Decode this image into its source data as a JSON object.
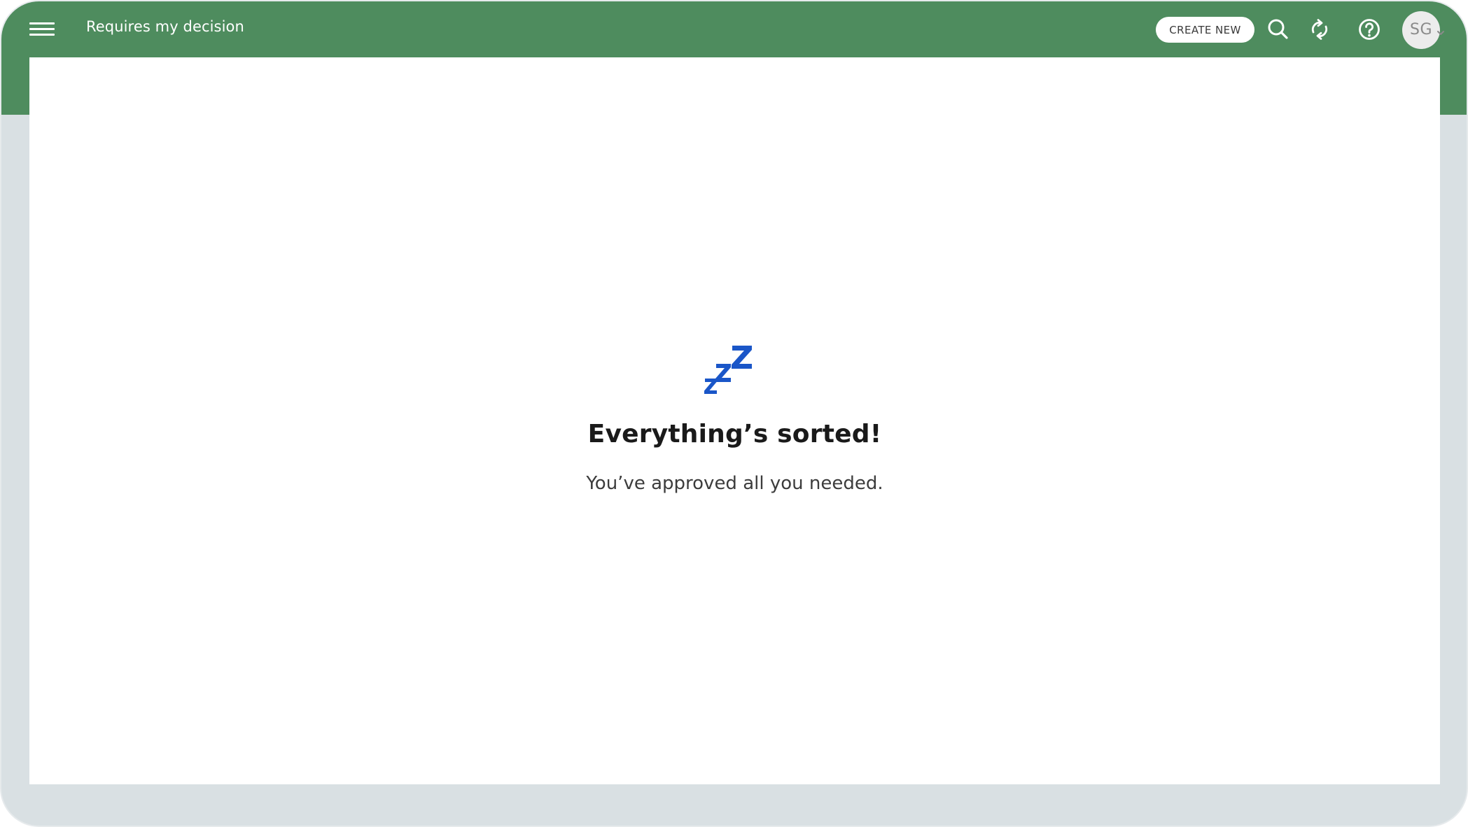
{
  "header": {
    "menu_icon": "hamburger-menu-icon",
    "title": "Requires my decision",
    "create_label": "CREATE NEW",
    "search_icon": "search-icon",
    "refresh_icon": "refresh-icon",
    "help_icon": "help-icon",
    "avatar_initials": "SG",
    "avatar_menu_icon": "chevron-down-icon"
  },
  "empty_state": {
    "icon": "sleeping-zzz-icon",
    "title": "Everything’s sorted!",
    "subtitle": "You’ve approved all you needed."
  },
  "colors": {
    "header_green": "#4e8c5e",
    "frame_gray": "#d9e0e3",
    "zzz_blue": "#1a56c8",
    "text_dark": "#1a1a1a"
  }
}
